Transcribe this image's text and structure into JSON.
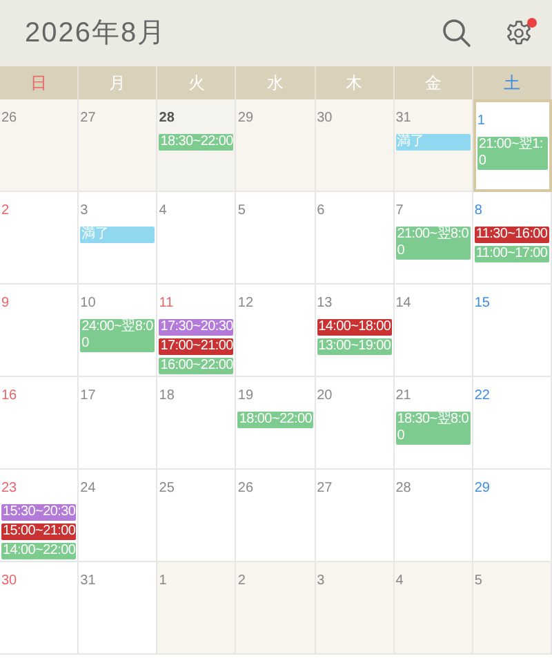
{
  "header": {
    "title": "2026年8月",
    "settings_badge": true
  },
  "weekdays": [
    "日",
    "月",
    "火",
    "水",
    "木",
    "金",
    "土"
  ],
  "weeks": [
    [
      {
        "date": "26",
        "other_month": true,
        "today": false,
        "selected": false
      },
      {
        "date": "27",
        "other_month": true,
        "today": false,
        "selected": false
      },
      {
        "date": "28",
        "other_month": true,
        "today": true,
        "selected": false,
        "events": [
          {
            "label": "18:30~22:00",
            "color": "#7dcb8f"
          }
        ]
      },
      {
        "date": "29",
        "other_month": true,
        "today": false,
        "selected": false
      },
      {
        "date": "30",
        "other_month": true,
        "today": false,
        "selected": false
      },
      {
        "date": "31",
        "other_month": true,
        "today": false,
        "selected": false,
        "events": [
          {
            "label": "満了",
            "color": "#8fd8ef"
          }
        ]
      },
      {
        "date": "1",
        "other_month": false,
        "today": false,
        "selected": true,
        "holiday": false,
        "events": [
          {
            "label": "21:00~翌1:0",
            "color": "#7dcb8f"
          }
        ]
      }
    ],
    [
      {
        "date": "2",
        "other_month": false,
        "today": false,
        "selected": false
      },
      {
        "date": "3",
        "other_month": false,
        "today": false,
        "selected": false,
        "holiday": false,
        "events": [
          {
            "label": "満了",
            "color": "#8fd8ef"
          }
        ]
      },
      {
        "date": "4",
        "other_month": false,
        "today": false,
        "selected": false,
        "holiday": false
      },
      {
        "date": "5",
        "other_month": false,
        "today": false,
        "selected": false,
        "holiday": false
      },
      {
        "date": "6",
        "other_month": false,
        "today": false,
        "selected": false,
        "holiday": false
      },
      {
        "date": "7",
        "other_month": false,
        "today": false,
        "selected": false,
        "holiday": false,
        "events": [
          {
            "label": "21:00~翌8:00",
            "color": "#7dcb8f"
          }
        ]
      },
      {
        "date": "8",
        "other_month": false,
        "today": false,
        "selected": false,
        "holiday": false,
        "events": [
          {
            "label": "11:30~16:00",
            "color": "#c83232"
          },
          {
            "label": "11:00~17:00",
            "color": "#7dcb8f"
          }
        ]
      }
    ],
    [
      {
        "date": "9",
        "other_month": false,
        "today": false,
        "selected": false
      },
      {
        "date": "10",
        "other_month": false,
        "today": false,
        "selected": false,
        "holiday": false,
        "events": [
          {
            "label": "24:00~翌8:00",
            "color": "#7dcb8f"
          }
        ]
      },
      {
        "date": "11",
        "other_month": false,
        "today": false,
        "selected": false,
        "holiday": true,
        "events": [
          {
            "label": "17:30~20:30",
            "color": "#b37ad8"
          },
          {
            "label": "17:00~21:00",
            "color": "#c83232"
          },
          {
            "label": "16:00~22:00",
            "color": "#7dcb8f"
          }
        ]
      },
      {
        "date": "12",
        "other_month": false,
        "today": false,
        "selected": false,
        "holiday": false
      },
      {
        "date": "13",
        "other_month": false,
        "today": false,
        "selected": false,
        "holiday": false,
        "events": [
          {
            "label": "14:00~18:00",
            "color": "#c83232"
          },
          {
            "label": "13:00~19:00",
            "color": "#7dcb8f"
          }
        ]
      },
      {
        "date": "14",
        "other_month": false,
        "today": false,
        "selected": false,
        "holiday": false
      },
      {
        "date": "15",
        "other_month": false,
        "today": false,
        "selected": false,
        "holiday": false
      }
    ],
    [
      {
        "date": "16",
        "other_month": false,
        "today": false,
        "selected": false
      },
      {
        "date": "17",
        "other_month": false,
        "today": false,
        "selected": false,
        "holiday": false
      },
      {
        "date": "18",
        "other_month": false,
        "today": false,
        "selected": false,
        "holiday": false
      },
      {
        "date": "19",
        "other_month": false,
        "today": false,
        "selected": false,
        "holiday": false,
        "events": [
          {
            "label": "18:00~22:00",
            "color": "#7dcb8f"
          }
        ]
      },
      {
        "date": "20",
        "other_month": false,
        "today": false,
        "selected": false,
        "holiday": false
      },
      {
        "date": "21",
        "other_month": false,
        "today": false,
        "selected": false,
        "holiday": false,
        "events": [
          {
            "label": "18:30~翌8:00",
            "color": "#7dcb8f"
          }
        ]
      },
      {
        "date": "22",
        "other_month": false,
        "today": false,
        "selected": false,
        "holiday": false
      }
    ],
    [
      {
        "date": "23",
        "other_month": false,
        "today": false,
        "selected": false,
        "events": [
          {
            "label": "15:30~20:30",
            "color": "#b37ad8"
          },
          {
            "label": "15:00~21:00",
            "color": "#c83232"
          },
          {
            "label": "14:00~22:00",
            "color": "#7dcb8f"
          }
        ]
      },
      {
        "date": "24",
        "other_month": false,
        "today": false,
        "selected": false,
        "holiday": false
      },
      {
        "date": "25",
        "other_month": false,
        "today": false,
        "selected": false,
        "holiday": false
      },
      {
        "date": "26",
        "other_month": false,
        "today": false,
        "selected": false,
        "holiday": false
      },
      {
        "date": "27",
        "other_month": false,
        "today": false,
        "selected": false,
        "holiday": false
      },
      {
        "date": "28",
        "other_month": false,
        "today": false,
        "selected": false,
        "holiday": false
      },
      {
        "date": "29",
        "other_month": false,
        "today": false,
        "selected": false,
        "holiday": false
      }
    ],
    [
      {
        "date": "30",
        "other_month": false,
        "today": false,
        "selected": false
      },
      {
        "date": "31",
        "other_month": false,
        "today": false,
        "selected": false,
        "holiday": false
      },
      {
        "date": "1",
        "other_month": true,
        "today": false,
        "selected": false
      },
      {
        "date": "2",
        "other_month": true,
        "today": false,
        "selected": false
      },
      {
        "date": "3",
        "other_month": true,
        "today": false,
        "selected": false
      },
      {
        "date": "4",
        "other_month": true,
        "today": false,
        "selected": false
      },
      {
        "date": "5",
        "other_month": true,
        "today": false,
        "selected": false
      }
    ]
  ]
}
